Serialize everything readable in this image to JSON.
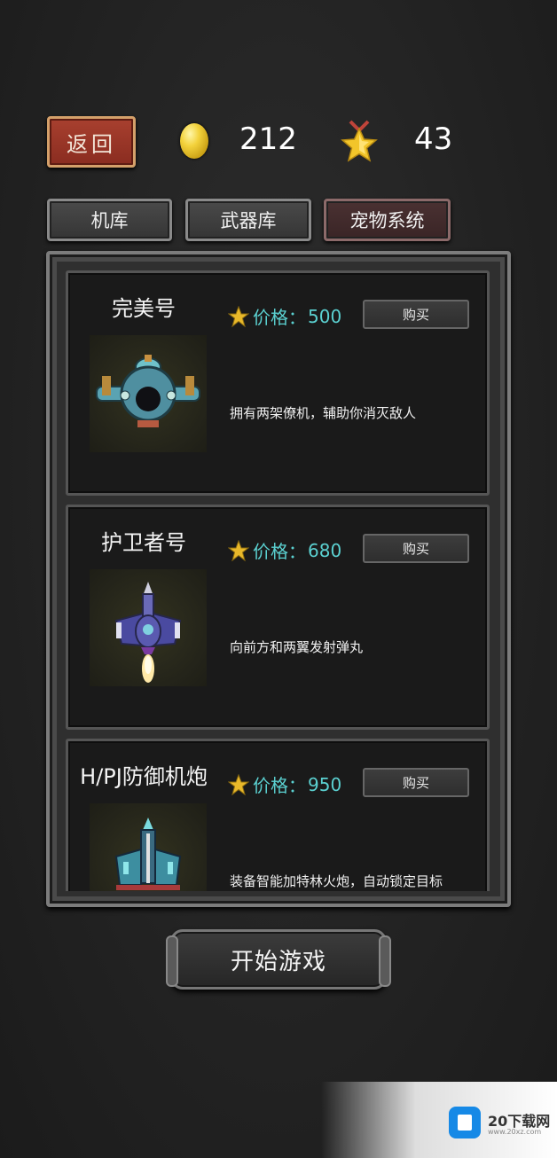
{
  "header": {
    "back_label": "返回",
    "coins": "212",
    "stars": "43"
  },
  "tabs": [
    {
      "label": "机库",
      "active": false
    },
    {
      "label": "武器库",
      "active": false
    },
    {
      "label": "宠物系统",
      "active": true
    }
  ],
  "items": [
    {
      "name": "完美号",
      "price_label": "价格：",
      "price": "500",
      "buy_label": "购买",
      "description": "拥有两架僚机，辅助你消灭敌人"
    },
    {
      "name": "护卫者号",
      "price_label": "价格：",
      "price": "680",
      "buy_label": "购买",
      "description": "向前方和两翼发射弹丸"
    },
    {
      "name": "H/PJ防御机炮",
      "price_label": "价格：",
      "price": "950",
      "buy_label": "购买",
      "description": "装备智能加特林火炮，自动锁定目标"
    }
  ],
  "start_label": "开始游戏",
  "watermark": {
    "text": "20下载网",
    "sub": "www.20xz.com"
  },
  "colors": {
    "price": "#5bd1d1",
    "back_button": "#9a3526",
    "active_tab": "#3a2526"
  }
}
